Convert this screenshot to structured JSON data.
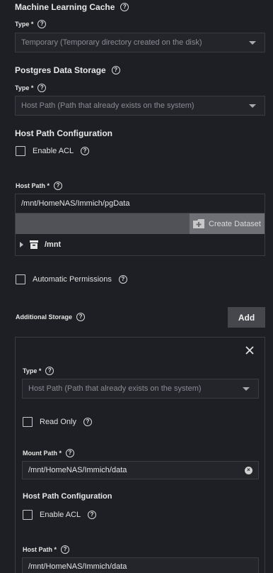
{
  "ml_cache": {
    "title": "Machine Learning Cache",
    "type_label": "Type *",
    "type_value": "Temporary (Temporary directory created on the disk)"
  },
  "postgres": {
    "title": "Postgres Data Storage",
    "type_label": "Type *",
    "type_value": "Host Path (Path that already exists on the system)"
  },
  "host_path_config": {
    "title": "Host Path Configuration",
    "enable_acl": "Enable ACL",
    "host_path_label": "Host Path *",
    "host_path_value": "/mnt/HomeNAS/Immich/pgData",
    "create_dataset": "Create Dataset",
    "tree_root": "/mnt"
  },
  "automatic_permissions": "Automatic Permissions",
  "additional_storage": {
    "title": "Additional Storage",
    "add_button": "Add",
    "item": {
      "type_label": "Type *",
      "type_value": "Host Path (Path that already exists on the system)",
      "read_only": "Read Only",
      "mount_path_label": "Mount Path *",
      "mount_path_value": "/mnt/HomeNAS/Immich/data",
      "host_path_config_title": "Host Path Configuration",
      "enable_acl": "Enable ACL",
      "host_path_label": "Host Path *",
      "host_path_value": "/mnt/HomeNAS/Immich/data"
    }
  },
  "icons": [
    "help-icon",
    "chevron-down-icon",
    "folder-plus-icon",
    "expand-arrow-icon",
    "dataset-icon",
    "close-icon",
    "clear-icon"
  ]
}
